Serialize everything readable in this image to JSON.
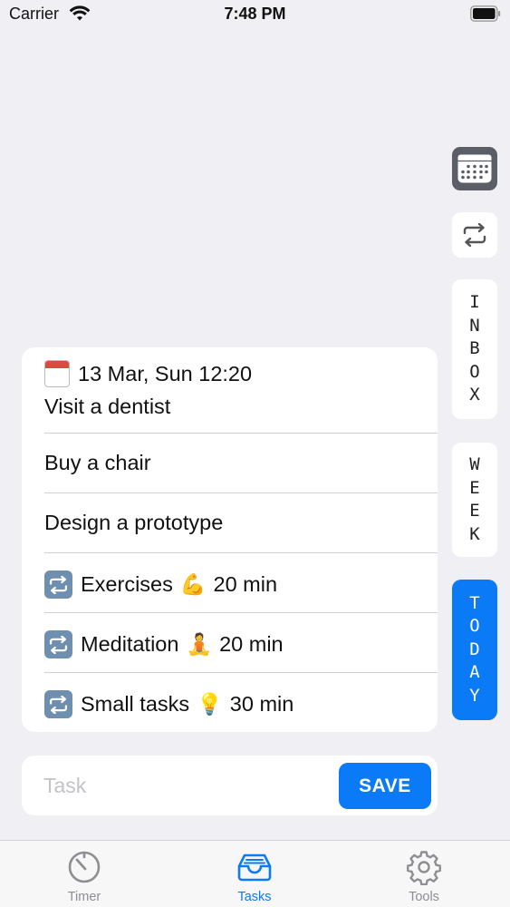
{
  "status_bar": {
    "carrier": "Carrier",
    "time": "7:48 PM"
  },
  "side_rail": {
    "inbox_letters": [
      "I",
      "N",
      "B",
      "O",
      "X"
    ],
    "week_letters": [
      "W",
      "E",
      "E",
      "K"
    ],
    "today_letters": [
      "T",
      "O",
      "D",
      "A",
      "Y"
    ],
    "active": "TODAY",
    "accent": "#0a7af7"
  },
  "tasks": [
    {
      "date": "13 Mar, Sun 12:20",
      "title": "Visit a dentist",
      "icon": "calendar-emoji"
    },
    {
      "title": "Buy a chair"
    },
    {
      "title": "Design a prototype"
    },
    {
      "title": "Exercises",
      "emoji": "💪",
      "duration": "20 min",
      "icon": "repeat-emoji"
    },
    {
      "title": "Meditation",
      "emoji": "🧘",
      "duration": "20 min",
      "icon": "repeat-emoji"
    },
    {
      "title": "Small tasks",
      "emoji": "💡",
      "duration": "30 min",
      "icon": "repeat-emoji"
    }
  ],
  "input": {
    "placeholder": "Task",
    "value": "",
    "save_label": "SAVE"
  },
  "tab_bar": {
    "tabs": [
      {
        "label": "Timer",
        "icon": "timer-icon"
      },
      {
        "label": "Tasks",
        "icon": "inbox-tray-icon"
      },
      {
        "label": "Tools",
        "icon": "gear-icon"
      }
    ],
    "active": "Tasks"
  }
}
